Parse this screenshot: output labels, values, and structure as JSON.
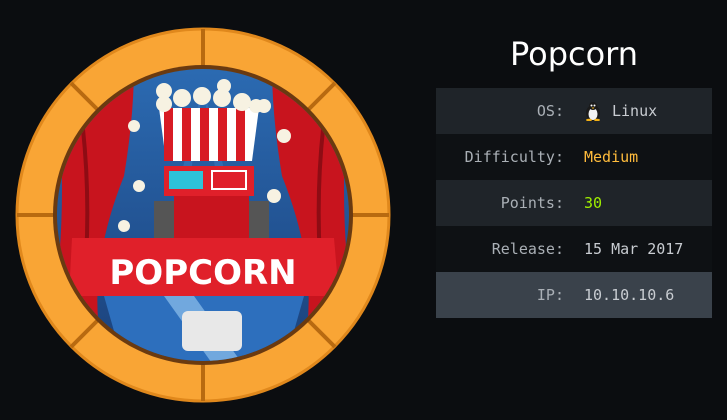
{
  "machine": {
    "title": "Popcorn",
    "badge_text": "POPCORN"
  },
  "info": {
    "os_label": "OS:",
    "os_value": "Linux",
    "os_icon": "tux-penguin-icon",
    "difficulty_label": "Difficulty:",
    "difficulty_value": "Medium",
    "points_label": "Points:",
    "points_value": "30",
    "release_label": "Release:",
    "release_value": "15 Mar 2017",
    "ip_label": "IP:",
    "ip_value": "10.10.10.6"
  },
  "colors": {
    "background": "#0b0d10",
    "difficulty_medium": "#ffbc3c",
    "points": "#9fef00",
    "ring": "#f9a535"
  }
}
